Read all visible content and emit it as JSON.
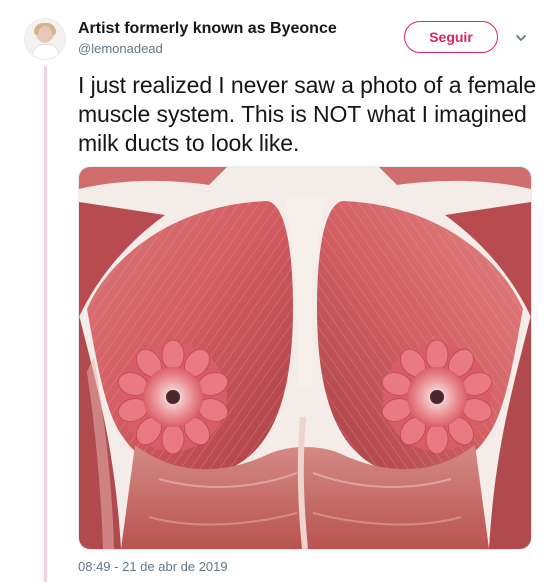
{
  "tweet": {
    "display_name": "Artist formerly known as Byeonce",
    "username": "@lemonadead",
    "follow_label": "Seguir",
    "text": "I just realized I never saw a photo of a female muscle system. This is NOT what I imagined milk ducts to look like.",
    "timestamp": "08:49 - 21 de abr de 2019",
    "media_alt": "Anatomical illustration of female chest muscles with radial mammary gland lobes"
  },
  "icons": {
    "menu": "chevron-down-icon"
  },
  "colors": {
    "accent": "#e0245e",
    "secondary_text": "#657786",
    "thread_line": "#f3d3d9"
  }
}
